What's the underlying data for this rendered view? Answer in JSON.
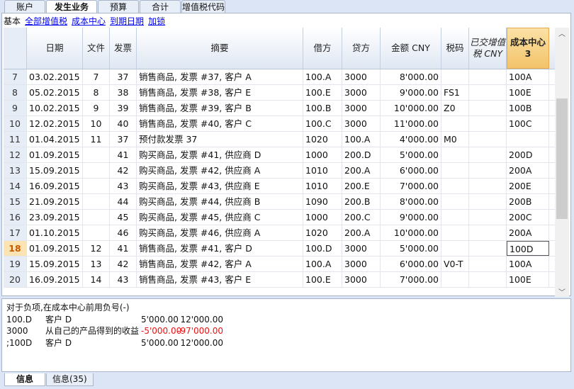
{
  "tabs": [
    "账户",
    "发生业务",
    "预算",
    "合计",
    "增值税代码"
  ],
  "views": [
    "基本",
    "全部增值税",
    "成本中心",
    "到期日期",
    "加锁"
  ],
  "columns": [
    "",
    "日期",
    "文件",
    "发票",
    "摘要",
    "借方",
    "贷方",
    "金额 CNY",
    "税码",
    "已交增值税 CNY",
    "成本中心\n3"
  ],
  "rows": [
    [
      "7",
      "03.02.2015",
      "7",
      "37",
      "销售商品, 发票 #37, 客户 A",
      "100.A",
      "3000",
      "8'000.00",
      "",
      "",
      "100A"
    ],
    [
      "8",
      "05.02.2015",
      "8",
      "38",
      "销售商品, 发票 #38, 客户 E",
      "100.E",
      "3000",
      "9'000.00",
      "FS1",
      "",
      "100E"
    ],
    [
      "9",
      "10.02.2015",
      "9",
      "39",
      "销售商品, 发票 #39, 客户 B",
      "100.B",
      "3000",
      "10'000.00",
      "Z0",
      "",
      "100B"
    ],
    [
      "10",
      "12.02.2015",
      "10",
      "40",
      "销售商品, 发票 #40, 客户 C",
      "100.C",
      "3000",
      "11'000.00",
      "",
      "",
      "100C"
    ],
    [
      "11",
      "01.04.2015",
      "11",
      "37",
      "预付款发票 37",
      "1020",
      "100.A",
      "4'000.00",
      "M0",
      "",
      ""
    ],
    [
      "12",
      "01.09.2015",
      "",
      "41",
      "购买商品, 发票 #41, 供应商 D",
      "1000",
      "200.D",
      "5'000.00",
      "",
      "",
      "200D"
    ],
    [
      "13",
      "15.09.2015",
      "",
      "42",
      "购买商品, 发票 #42, 供应商 A",
      "1010",
      "200.A",
      "6'000.00",
      "",
      "",
      "200A"
    ],
    [
      "14",
      "16.09.2015",
      "",
      "43",
      "购买商品, 发票 #43, 供应商 E",
      "1010",
      "200.E",
      "7'000.00",
      "",
      "",
      "200E"
    ],
    [
      "15",
      "21.09.2015",
      "",
      "44",
      "购买商品, 发票 #44, 供应商 B",
      "1090",
      "200.B",
      "8'000.00",
      "",
      "",
      "200B"
    ],
    [
      "16",
      "23.09.2015",
      "",
      "45",
      "购买商品, 发票 #45, 供应商 C",
      "1000",
      "200.C",
      "9'000.00",
      "",
      "",
      "200C"
    ],
    [
      "17",
      "01.10.2015",
      "",
      "46",
      "购买商品, 发票 #46, 供应商 A",
      "1020",
      "200.A",
      "10'000.00",
      "",
      "",
      "200A"
    ],
    [
      "18",
      "01.09.2015",
      "12",
      "41",
      "销售商品, 发票 #41, 客户 D",
      "100.D",
      "3000",
      "5'000.00",
      "",
      "",
      "100D"
    ],
    [
      "19",
      "15.09.2015",
      "13",
      "42",
      "销售商品, 发票 #42, 客户 A",
      "100.A",
      "3000",
      "6'000.00",
      "V0-T",
      "",
      "100A"
    ],
    [
      "20",
      "16.09.2015",
      "14",
      "43",
      "销售商品, 发票 #43, 客户 E",
      "100.E",
      "3000",
      "7'000.00",
      "",
      "",
      "100E"
    ]
  ],
  "selected_row": "18",
  "info": {
    "title": "对于负项,在成本中心前用负号(-)",
    "lines": [
      [
        "100.D",
        "客户 D",
        "5'000.00",
        "12'000.00"
      ],
      [
        "3000",
        "从自己的产品得到的收益",
        "-5'000.00",
        "-97'000.00"
      ],
      [
        ";100D",
        "客户 D",
        "5'000.00",
        "12'000.00"
      ]
    ]
  },
  "bottom_tabs": [
    "信息",
    "信息(35)"
  ]
}
